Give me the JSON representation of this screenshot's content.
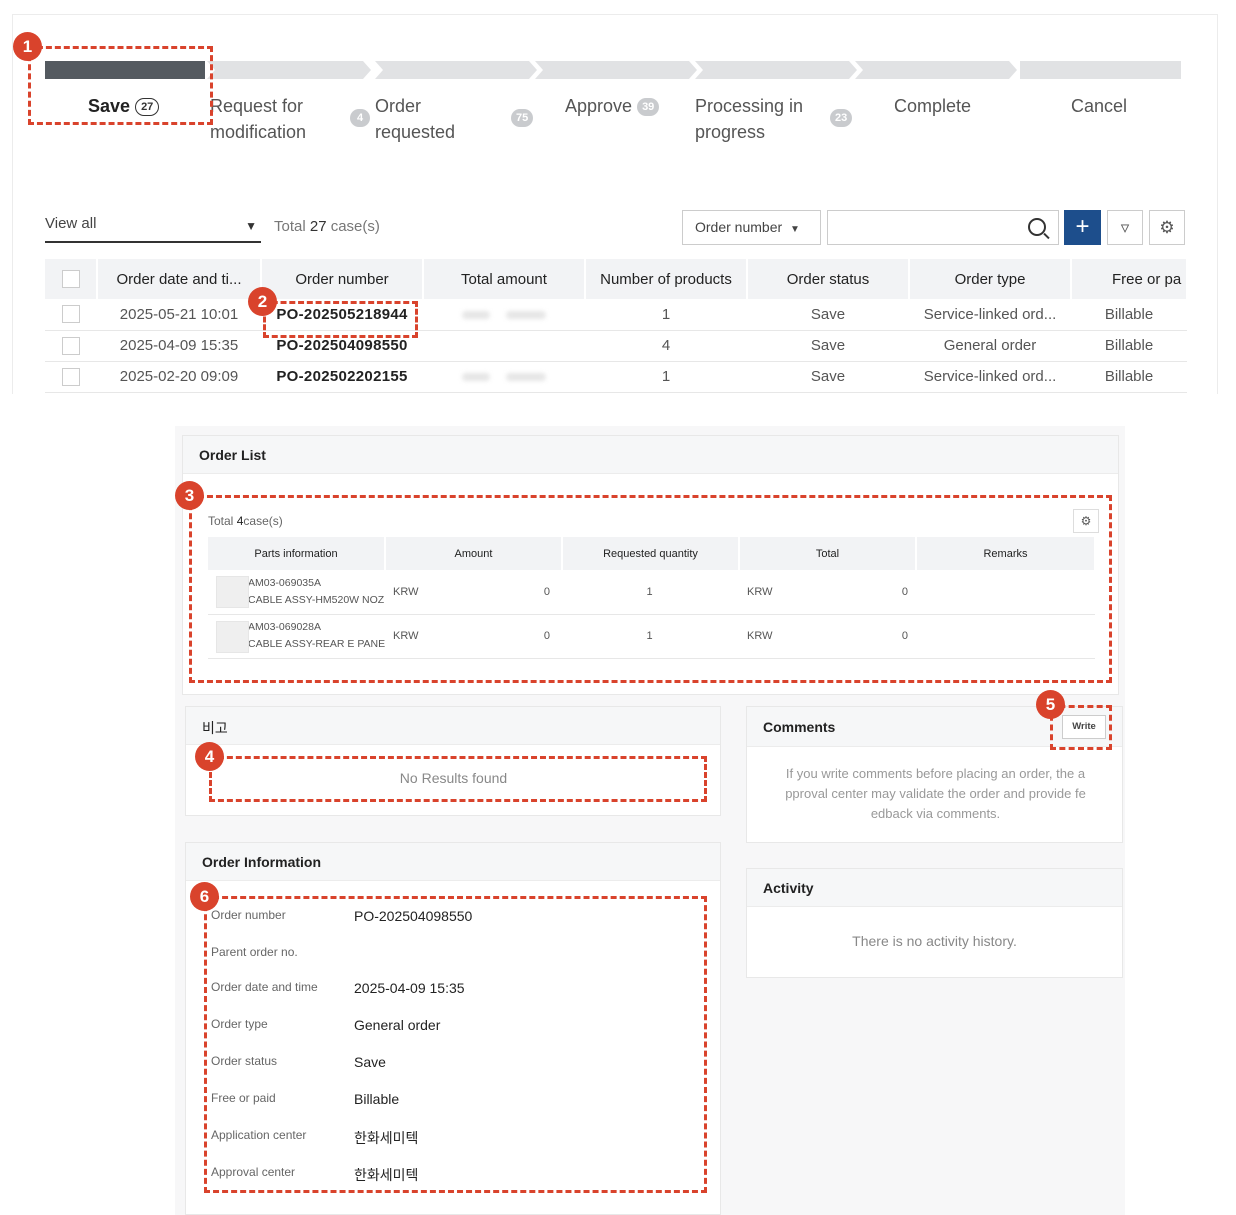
{
  "steps": [
    {
      "label": "Save",
      "count": "27",
      "active": true
    },
    {
      "label": "Request for modification",
      "count": "4"
    },
    {
      "label": "Order requested",
      "count": "75"
    },
    {
      "label": "Approve",
      "count": "39"
    },
    {
      "label": "Processing in progress",
      "count": "23"
    },
    {
      "label": "Complete",
      "count": ""
    },
    {
      "label": "Cancel",
      "count": ""
    }
  ],
  "filter": {
    "view_all": "View all",
    "total_prefix": "Total",
    "total_count": "27",
    "total_suffix": "case(s)",
    "search_field": "Order number",
    "search_placeholder": ""
  },
  "orders_table": {
    "headers": [
      "Order date and ti...",
      "Order number",
      "Total amount",
      "Number of products",
      "Order status",
      "Order type",
      "Free or pa"
    ],
    "rows": [
      {
        "date": "2025-05-21 10:01",
        "number": "PO-202505218944",
        "products": "1",
        "status": "Save",
        "type": "Service-linked ord...",
        "paid": "Billable"
      },
      {
        "date": "2025-04-09 15:35",
        "number": "PO-202504098550",
        "products": "4",
        "status": "Save",
        "type": "General order",
        "paid": "Billable"
      },
      {
        "date": "2025-02-20 09:09",
        "number": "PO-202502202155",
        "products": "1",
        "status": "Save",
        "type": "Service-linked ord...",
        "paid": "Billable"
      }
    ]
  },
  "order_list": {
    "title": "Order List",
    "total_prefix": "Total",
    "total_count": "4",
    "total_suffix": "case(s)",
    "headers": [
      "Parts information",
      "Amount",
      "Requested quantity",
      "Total",
      "Remarks"
    ],
    "rows": [
      {
        "code": "AM03-069035A",
        "name": "CABLE ASSY-HM520W NOZ",
        "currency": "KRW",
        "amount": "0",
        "qty": "1",
        "total_currency": "KRW",
        "total": "0",
        "remarks": ""
      },
      {
        "code": "AM03-069028A",
        "name": "CABLE ASSY-REAR E PANEL",
        "currency": "KRW",
        "amount": "0",
        "qty": "1",
        "total_currency": "KRW",
        "total": "0",
        "remarks": ""
      }
    ]
  },
  "remarks": {
    "title": "비고",
    "empty": "No Results found"
  },
  "comments": {
    "title": "Comments",
    "write": "Write",
    "text": "If you write comments before placing an order, the a pproval center may validate the order and provide fe edback via comments."
  },
  "activity": {
    "title": "Activity",
    "empty": "There is no activity history."
  },
  "order_info": {
    "title": "Order Information",
    "fields": [
      {
        "label": "Order number",
        "value": "PO-202504098550"
      },
      {
        "label": "Parent order no.",
        "value": ""
      },
      {
        "label": "Order date and time",
        "value": "2025-04-09 15:35"
      },
      {
        "label": "Order type",
        "value": "General order"
      },
      {
        "label": "Order status",
        "value": "Save"
      },
      {
        "label": "Free or paid",
        "value": "Billable"
      },
      {
        "label": "Application center",
        "value": "한화세미텍"
      },
      {
        "label": "Approval center",
        "value": "한화세미텍"
      }
    ]
  },
  "markers": [
    "1",
    "2",
    "3",
    "4",
    "5",
    "6"
  ],
  "colors": {
    "accent": "#1d4e8c",
    "annotation": "#d9432c",
    "active_step": "#545a60"
  }
}
